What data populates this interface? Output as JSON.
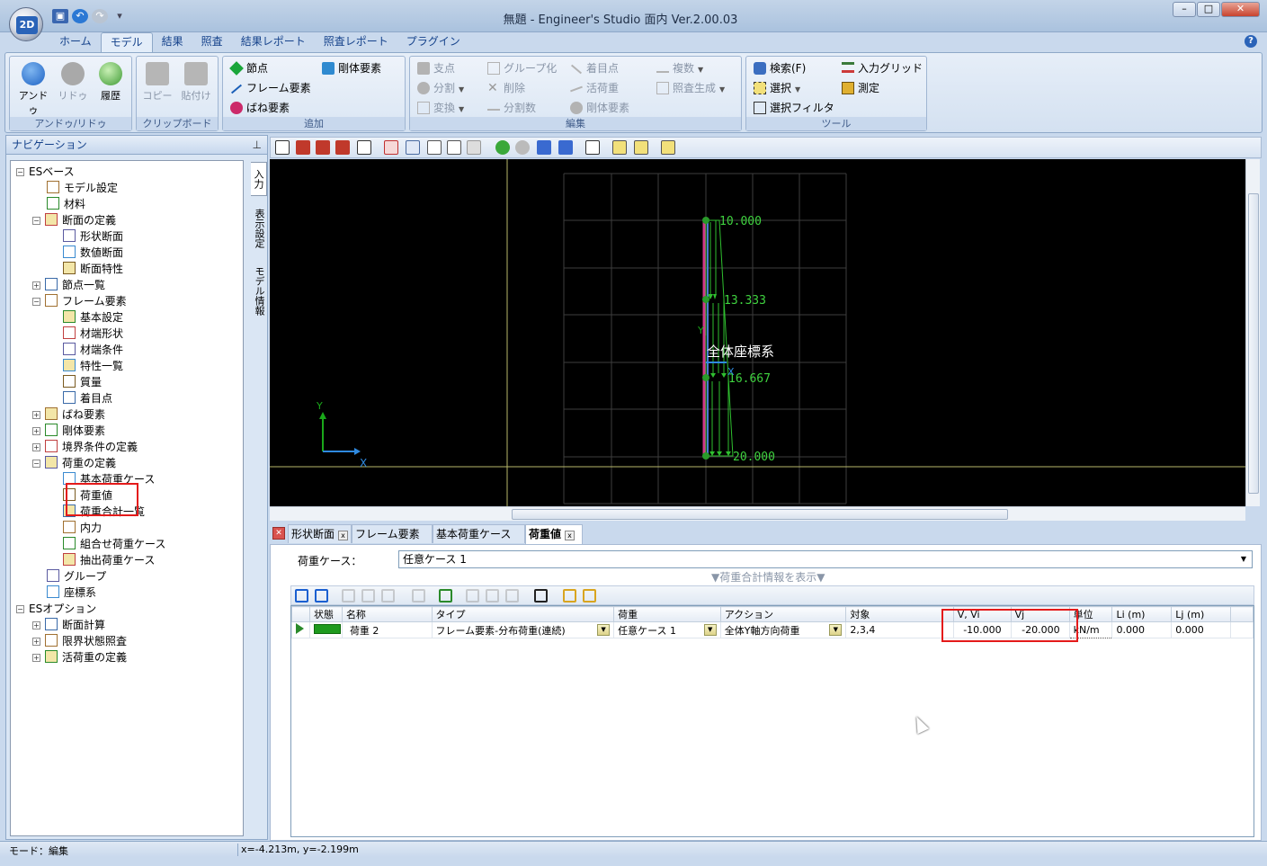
{
  "window": {
    "title": "無題 - Engineer's Studio 面内 Ver.2.00.03",
    "app_logo": "2D"
  },
  "menu_tabs": [
    "ホーム",
    "モデル",
    "結果",
    "照査",
    "結果レポート",
    "照査レポート",
    "プラグイン"
  ],
  "active_tab": "モデル",
  "ribbon": {
    "undo_group": {
      "label": "アンドゥ/リドゥ",
      "undo": "アンドゥ",
      "redo": "リドゥ",
      "history": "履歴"
    },
    "clipboard_group": {
      "label": "クリップボード",
      "copy": "コピー",
      "paste": "貼付け"
    },
    "add_group": {
      "label": "追加",
      "node": "節点",
      "frame": "フレーム要素",
      "spring": "ばね要素",
      "rigid": "剛体要素"
    },
    "edit_group": {
      "label": "編集",
      "support": "支点",
      "group": "グループ化",
      "focus": "着目点",
      "duplicate": "複数",
      "split": "分割",
      "delete": "削除",
      "live_load": "活荷重",
      "inspect_gen": "照査生成",
      "transform": "変換",
      "split_count": "分割数",
      "rigid_elem": "剛体要素"
    },
    "tool_group": {
      "label": "ツール",
      "search": "検索(F)",
      "input_grid": "入力グリッド",
      "select": "選択",
      "measure": "測定",
      "select_filter": "選択フィルタ"
    }
  },
  "nav": {
    "title": "ナビゲーション",
    "vertical_tabs": [
      "入力",
      "表示設定",
      "モデル情報"
    ],
    "tree": [
      {
        "label": "ESベース",
        "level": 0,
        "expander": "−"
      },
      {
        "label": "モデル設定",
        "level": 1
      },
      {
        "label": "材料",
        "level": 1
      },
      {
        "label": "断面の定義",
        "level": 1,
        "expander": "−"
      },
      {
        "label": "形状断面",
        "level": 2
      },
      {
        "label": "数値断面",
        "level": 2
      },
      {
        "label": "断面特性",
        "level": 2
      },
      {
        "label": "節点一覧",
        "level": 1,
        "expander": "+"
      },
      {
        "label": "フレーム要素",
        "level": 1,
        "expander": "−"
      },
      {
        "label": "基本設定",
        "level": 2
      },
      {
        "label": "材端形状",
        "level": 2
      },
      {
        "label": "材端条件",
        "level": 2
      },
      {
        "label": "特性一覧",
        "level": 2
      },
      {
        "label": "質量",
        "level": 2
      },
      {
        "label": "着目点",
        "level": 2
      },
      {
        "label": "ばね要素",
        "level": 1,
        "expander": "+"
      },
      {
        "label": "剛体要素",
        "level": 1,
        "expander": "+"
      },
      {
        "label": "境界条件の定義",
        "level": 1,
        "expander": "+"
      },
      {
        "label": "荷重の定義",
        "level": 1,
        "expander": "−"
      },
      {
        "label": "基本荷重ケース",
        "level": 2
      },
      {
        "label": "荷重値",
        "level": 2
      },
      {
        "label": "荷重合計一覧",
        "level": 2
      },
      {
        "label": "内力",
        "level": 2
      },
      {
        "label": "組合せ荷重ケース",
        "level": 2
      },
      {
        "label": "抽出荷重ケース",
        "level": 2
      },
      {
        "label": "グループ",
        "level": 1
      },
      {
        "label": "座標系",
        "level": 1
      },
      {
        "label": "ESオプション",
        "level": 0,
        "expander": "−"
      },
      {
        "label": "断面計算",
        "level": 1,
        "expander": "+"
      },
      {
        "label": "限界状態照査",
        "level": 1,
        "expander": "+"
      },
      {
        "label": "活荷重の定義",
        "level": 1,
        "expander": "+"
      }
    ]
  },
  "viewport": {
    "load_labels": [
      "10.000",
      "13.333",
      "16.667",
      "20.000"
    ],
    "coord_label": "全体座標系",
    "axis_x": "X",
    "axis_y": "Y",
    "local_x": "X",
    "local_y": "Y"
  },
  "detail_tabs": [
    "形状断面",
    "フレーム要素",
    "基本荷重ケース",
    "荷重値"
  ],
  "active_detail_tab": "荷重値",
  "load_case": {
    "label": "荷重ケース：",
    "value": "任意ケース 1"
  },
  "show_info": "▼荷重合計情報を表示▼",
  "table": {
    "headers": [
      "状態",
      "名称",
      "タイプ",
      "荷重",
      "アクション",
      "対象",
      "V, Vi",
      "Vj",
      "単位",
      "Li (m)",
      "Lj (m)"
    ],
    "rows": [
      {
        "name": "荷重 2",
        "type": "フレーム要素-分布荷重(連続)",
        "load": "任意ケース 1",
        "action": "全体Y軸方向荷重",
        "target": "2,3,4",
        "vi": "-10.000",
        "vj": "-20.000",
        "unit": "kN/m",
        "li": "0.000",
        "lj": "0.000"
      }
    ]
  },
  "status": {
    "mode": "モード：編集",
    "coords": "x=-4.213m, y=-2.199m"
  }
}
